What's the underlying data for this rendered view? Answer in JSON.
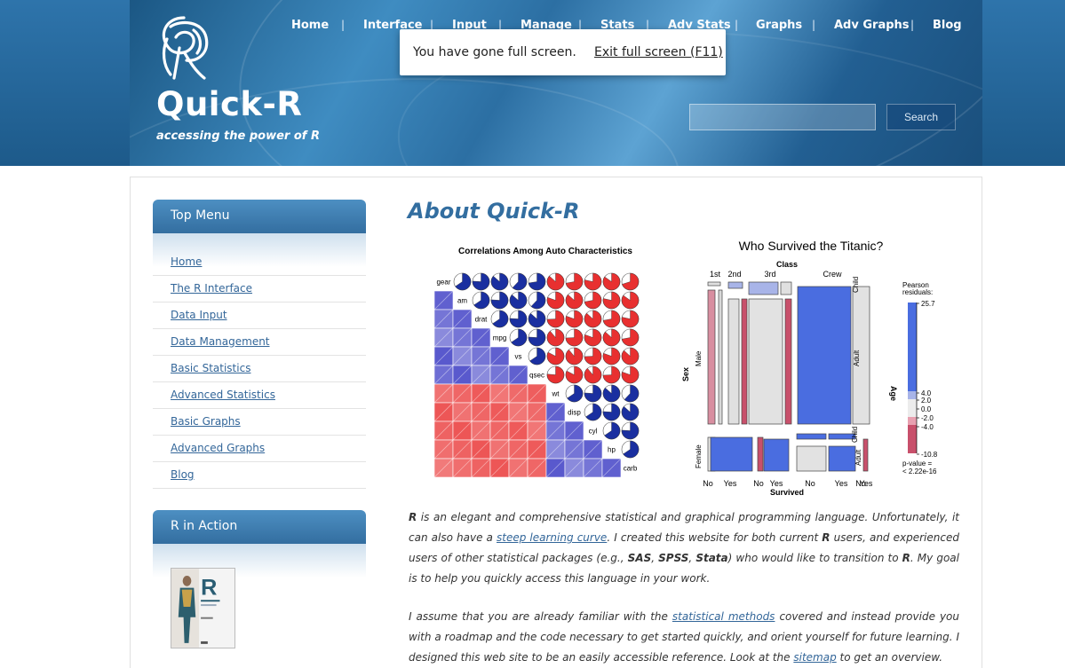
{
  "header": {
    "site_title": "Quick-R",
    "tagline": "accessing the power of R",
    "nav": [
      "Home",
      "Interface",
      "Input",
      "Manage",
      "Stats",
      "Adv Stats",
      "Graphs",
      "Adv Graphs",
      "Blog"
    ],
    "search_placeholder": "",
    "search_button": "Search"
  },
  "fullscreen_notice": {
    "text": "You have gone full screen.",
    "exit_link": "Exit full screen (F11)"
  },
  "sidebar": {
    "top_menu_title": "Top Menu",
    "items": [
      "Home",
      "The R Interface",
      "Data Input",
      "Data Management",
      "Basic Statistics",
      "Advanced Statistics",
      "Basic Graphs",
      "Advanced Graphs",
      "Blog"
    ],
    "r_in_action_title": "R in Action"
  },
  "main": {
    "title": "About Quick-R",
    "para1": {
      "r1": "R",
      "t1": " is an elegant and comprehensive statistical and graphical programming language. Unfortunately, it can also have a ",
      "link1": "steep learning curve",
      "t2": ". I created this website for both current ",
      "r2": "R",
      "t3": " users, and experienced users of other statistical packages (e.g., ",
      "sas": "SAS",
      "c1": ", ",
      "spss": "SPSS",
      "c2": ", ",
      "stata": "Stata",
      "t4": ") who would like to transition to ",
      "r3": "R",
      "t5": ". My goal is to help you quickly access this language in your work."
    },
    "para2": {
      "t1": "I assume that you are already familiar with the ",
      "link1": "statistical methods",
      "t2": " covered and instead provide you with a roadmap and the code necessary to get started quickly, and orient yourself for future learning. I designed this web site to be an easily accessible reference. Look at the ",
      "link2": "sitemap",
      "t3": " to get an overview."
    }
  },
  "chart_data": [
    {
      "type": "heatmap",
      "title": "Correlations Among Auto Characteristics",
      "variables": [
        "gear",
        "am",
        "drat",
        "mpg",
        "vs",
        "qsec",
        "wt",
        "disp",
        "cyl",
        "hp",
        "carb"
      ]
    },
    {
      "type": "mosaic",
      "title": "Who Survived the Titanic?",
      "class_label": "Class",
      "classes": [
        "1st",
        "2nd",
        "3rd",
        "Crew"
      ],
      "sex_label": "Sex",
      "sexes": [
        "Male",
        "Female"
      ],
      "age_label": "Age",
      "ages_top": [
        "Child",
        "Adult"
      ],
      "ages_bottom": [
        "Adult",
        "Child"
      ],
      "survived_label": "Survived",
      "survived_ticks": [
        "No",
        "Yes",
        "No",
        "Yes",
        "No",
        "Yes",
        "No",
        "Yes"
      ],
      "legend_title": [
        "Pearson",
        "residuals:"
      ],
      "legend_ticks": [
        "25.7",
        "4.0",
        "2.0",
        "0.0",
        "-2.0",
        "-4.0",
        "-10.8"
      ],
      "pvalue": [
        "p-value =",
        "< 2.22e-16"
      ]
    }
  ],
  "colors": {
    "header_blue": "#2c6fa3",
    "link": "#336699",
    "title": "#336ea0"
  }
}
